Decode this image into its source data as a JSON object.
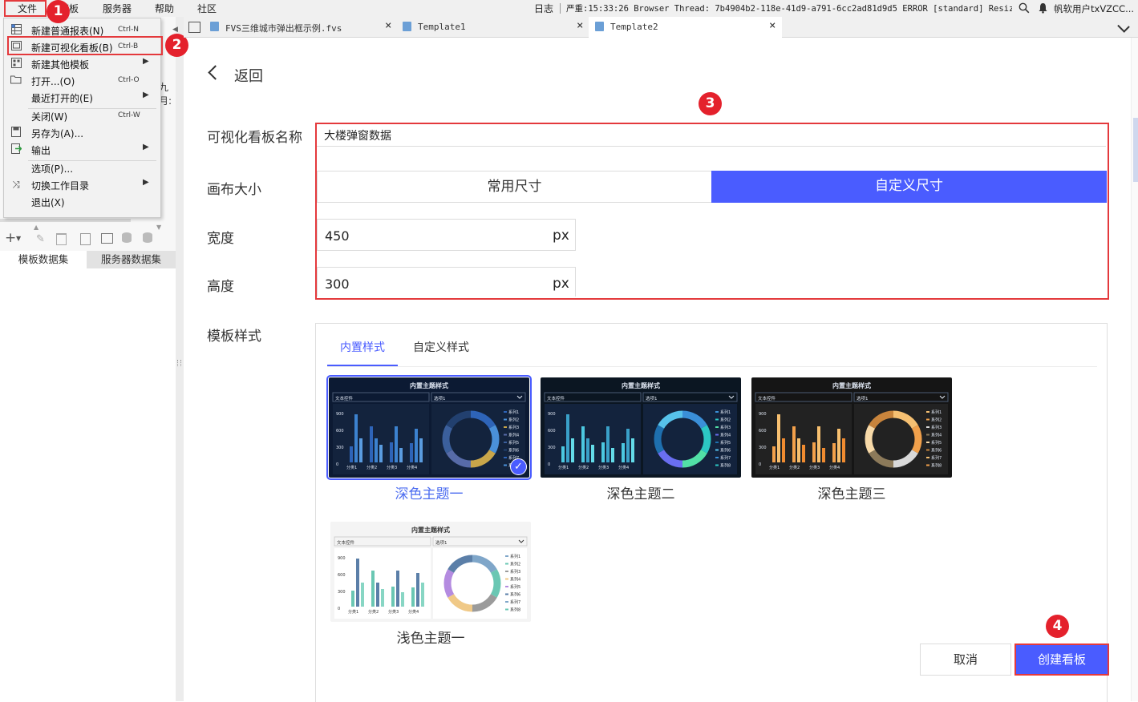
{
  "menubar": {
    "items": [
      "文件",
      "模板",
      "服务器",
      "帮助",
      "社区"
    ],
    "log_label": "日志",
    "status_text": "严重:15:33:26 Browser Thread: 7b4904b2-118e-41d9-a791-6cc2ad81d9d5 ERROR [standard] Resize...",
    "user_label": "帆软用户txVZCC..."
  },
  "file_menu": {
    "items": [
      {
        "label": "新建普通报表(N)",
        "shortcut": "Ctrl-N",
        "icon": "grid-report-icon"
      },
      {
        "label": "新建可视化看板(B)",
        "shortcut": "Ctrl-B",
        "icon": "dashboard-icon"
      },
      {
        "label": "新建其他模板",
        "shortcut": "",
        "icon": "template-icon",
        "submenu": true
      },
      {
        "label": "打开...(O)",
        "shortcut": "Ctrl-O",
        "icon": "folder-icon"
      },
      {
        "label": "最近打开的(E)",
        "shortcut": "",
        "icon": "",
        "submenu": true
      },
      {
        "label": "关闭(W)",
        "shortcut": "Ctrl-W",
        "icon": ""
      },
      {
        "label": "另存为(A)...",
        "shortcut": "",
        "icon": "save-as-icon"
      },
      {
        "label": "输出",
        "shortcut": "",
        "icon": "export-icon",
        "submenu": true
      },
      {
        "label": "选项(P)...",
        "shortcut": "",
        "icon": ""
      },
      {
        "label": "切换工作目录",
        "shortcut": "",
        "icon": "shuffle-icon",
        "submenu": true
      },
      {
        "label": "退出(X)",
        "shortcut": "",
        "icon": ""
      }
    ]
  },
  "left_panel": {
    "truncated_text": "九月:",
    "dataset_tabs": [
      "模板数据集",
      "服务器数据集"
    ]
  },
  "tabs": [
    {
      "label": "FVS三维城市弹出框示例.fvs",
      "active": false
    },
    {
      "label": "Template1",
      "active": false
    },
    {
      "label": "Template2",
      "active": true
    }
  ],
  "form": {
    "back_label": "返回",
    "name_label": "可视化看板名称",
    "name_value": "大楼弹窗数据",
    "size_label": "画布大小",
    "size_options": [
      "常用尺寸",
      "自定义尺寸"
    ],
    "size_selected": "自定义尺寸",
    "width_label": "宽度",
    "width_value": "450",
    "height_label": "高度",
    "height_value": "300",
    "unit": "px",
    "style_label": "模板样式",
    "style_tabs": [
      "内置样式",
      "自定义样式"
    ],
    "style_tab_active": "内置样式"
  },
  "themes": [
    {
      "name": "深色主题一",
      "selected": true,
      "bg": "#0c1a33",
      "accent": "#3c6bb0"
    },
    {
      "name": "深色主题二",
      "selected": false,
      "bg": "#0b1622",
      "accent": "#2fb0c8"
    },
    {
      "name": "深色主题三",
      "selected": false,
      "bg": "#151515",
      "accent": "#f0a04b"
    },
    {
      "name": "浅色主题一",
      "selected": false,
      "bg": "#f4f4f4",
      "accent": "#6ac7b3"
    }
  ],
  "theme_card": {
    "title": "内置主题样式",
    "control_label": "文本控件",
    "dropdown_label": "选项1",
    "y_ticks": [
      "900",
      "600",
      "300",
      "0"
    ],
    "categories": [
      "分类1",
      "分类2",
      "分类3",
      "分类4"
    ],
    "legend": [
      "系列1",
      "系列2",
      "系列3",
      "系列4",
      "系列5",
      "系列6",
      "系列7",
      "系列8"
    ]
  },
  "buttons": {
    "cancel": "取消",
    "create": "创建看板"
  },
  "annotations": [
    "1",
    "2",
    "3",
    "4"
  ],
  "colors": {
    "primary": "#4a5cff",
    "annotation_red": "#e4212c",
    "selected_theme_text": "#4b6cf0"
  }
}
